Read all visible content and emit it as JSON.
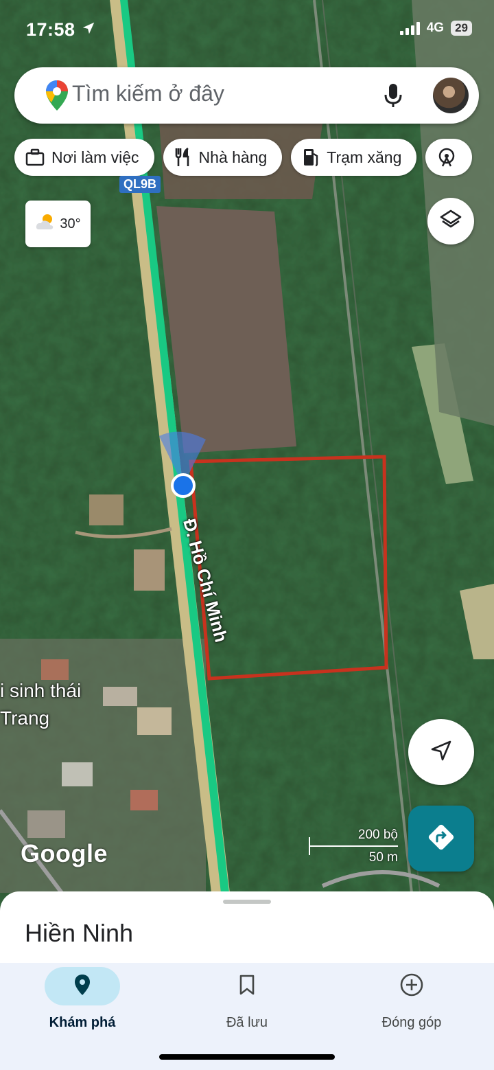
{
  "status": {
    "time": "17:58",
    "network": "4G",
    "battery": "29"
  },
  "search": {
    "placeholder": "Tìm kiếm ở đây"
  },
  "chips": [
    {
      "label": "Nơi làm việc",
      "icon": "briefcase-icon"
    },
    {
      "label": "Nhà hàng",
      "icon": "restaurant-icon"
    },
    {
      "label": "Trạm xăng",
      "icon": "gas-station-icon"
    },
    {
      "label": "",
      "icon": "attraction-icon"
    }
  ],
  "weather": {
    "temp": "30°"
  },
  "map": {
    "road_shield": "QL9B",
    "road_name": "Đ. Hồ Chí Minh",
    "place_line1": "i sinh thái",
    "place_line2": "Trang",
    "attribution": "Google",
    "scale_ft": "200 bộ",
    "scale_m": "50 m",
    "boundary_color": "#c8321e",
    "location_dot_color": "#1a73e8"
  },
  "sheet": {
    "title": "Hiền Ninh"
  },
  "nav": [
    {
      "label": "Khám phá",
      "icon": "explore-pin-icon",
      "active": true
    },
    {
      "label": "Đã lưu",
      "icon": "bookmark-icon",
      "active": false
    },
    {
      "label": "Đóng góp",
      "icon": "add-circle-icon",
      "active": false
    }
  ]
}
